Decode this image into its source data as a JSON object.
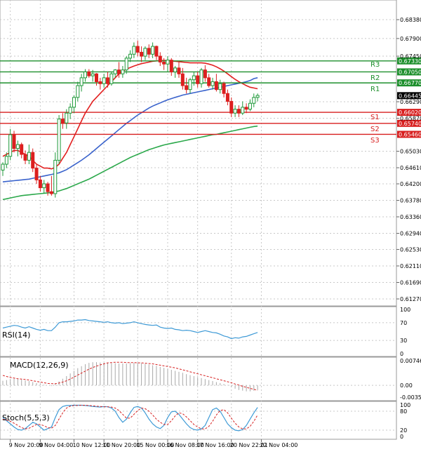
{
  "colors": {
    "bull": "#1f9a3a",
    "bear": "#dc1f1f",
    "sma_fast": "#e22020",
    "sma_mid": "#3a63cc",
    "sma_slow": "#2aa84a",
    "resistance": "#1d8f2c",
    "support": "#d81e1e",
    "rsi": "#3e9ad6",
    "macd_hist": "#a8a8a8",
    "macd_signal": "#d62020",
    "stoch_k": "#3e9ad6",
    "stoch_d": "#d62020",
    "grid": "#c8c8c8"
  },
  "chart_data": {
    "type": "candlestick",
    "price_axis_ticks": [
      "0.68380",
      "0.67900",
      "0.67450",
      "0.67330",
      "0.67050",
      "0.66770",
      "0.66445",
      "0.66290",
      "0.66020",
      "0.65870",
      "0.65740",
      "0.65460",
      "0.65030",
      "0.64610",
      "0.64200",
      "0.63780",
      "0.63360",
      "0.62940",
      "0.62530",
      "0.62110",
      "0.61690",
      "0.61270"
    ],
    "current_price": "0.66445",
    "time_labels": [
      {
        "label": "9 Nov 20:00",
        "bar": 2
      },
      {
        "label": "9 Nov 04:00",
        "bar": 10
      },
      {
        "label": "10 Nov 12:00",
        "bar": 19
      },
      {
        "label": "11 Nov 20:00",
        "bar": 27
      },
      {
        "label": "15 Nov 00:00",
        "bar": 36
      },
      {
        "label": "16 Nov 08:00",
        "bar": 44
      },
      {
        "label": "17 Nov 16:00",
        "bar": 52
      },
      {
        "label": "20 Nov 22:01",
        "bar": 61
      },
      {
        "label": "22 Nov 04:00",
        "bar": 69
      }
    ],
    "levels": [
      {
        "name": "R3",
        "value": 0.6733,
        "label": "0.67330",
        "kind": "resistance"
      },
      {
        "name": "R2",
        "value": 0.6705,
        "label": "0.67050",
        "kind": "resistance"
      },
      {
        "name": "R1",
        "value": 0.6677,
        "label": "0.66770",
        "kind": "resistance"
      },
      {
        "name": "S1",
        "value": 0.6602,
        "label": "0.66020",
        "kind": "support"
      },
      {
        "name": "S2",
        "value": 0.6574,
        "label": "0.65740",
        "kind": "support"
      },
      {
        "name": "S3",
        "value": 0.6546,
        "label": "0.65460",
        "kind": "support"
      }
    ],
    "ohlc": [
      [
        0.6455,
        0.6475,
        0.644,
        0.647
      ],
      [
        0.647,
        0.65,
        0.646,
        0.649
      ],
      [
        0.649,
        0.656,
        0.648,
        0.6545
      ],
      [
        0.6545,
        0.6555,
        0.65,
        0.651
      ],
      [
        0.651,
        0.653,
        0.649,
        0.652
      ],
      [
        0.652,
        0.6525,
        0.6485,
        0.6495
      ],
      [
        0.6495,
        0.6505,
        0.647,
        0.648
      ],
      [
        0.648,
        0.652,
        0.647,
        0.65
      ],
      [
        0.65,
        0.651,
        0.645,
        0.646
      ],
      [
        0.646,
        0.647,
        0.642,
        0.643
      ],
      [
        0.643,
        0.644,
        0.64,
        0.641
      ],
      [
        0.641,
        0.643,
        0.6395,
        0.642
      ],
      [
        0.642,
        0.6425,
        0.639,
        0.64
      ],
      [
        0.64,
        0.644,
        0.639,
        0.6395
      ],
      [
        0.6395,
        0.65,
        0.6385,
        0.648
      ],
      [
        0.648,
        0.6595,
        0.647,
        0.6585
      ],
      [
        0.6585,
        0.66,
        0.656,
        0.6575
      ],
      [
        0.6575,
        0.661,
        0.656,
        0.66
      ],
      [
        0.66,
        0.6625,
        0.6585,
        0.6615
      ],
      [
        0.6615,
        0.6645,
        0.66,
        0.664
      ],
      [
        0.664,
        0.668,
        0.663,
        0.667
      ],
      [
        0.667,
        0.67,
        0.6655,
        0.669
      ],
      [
        0.669,
        0.6712,
        0.668,
        0.6705
      ],
      [
        0.6705,
        0.6712,
        0.669,
        0.6695
      ],
      [
        0.6695,
        0.671,
        0.668,
        0.67
      ],
      [
        0.67,
        0.6702,
        0.667,
        0.668
      ],
      [
        0.668,
        0.669,
        0.666,
        0.6675
      ],
      [
        0.6675,
        0.67,
        0.6665,
        0.669
      ],
      [
        0.669,
        0.6705,
        0.6665,
        0.6675
      ],
      [
        0.6675,
        0.6705,
        0.667,
        0.67
      ],
      [
        0.67,
        0.6712,
        0.669,
        0.671
      ],
      [
        0.671,
        0.673,
        0.669,
        0.67
      ],
      [
        0.67,
        0.672,
        0.669,
        0.671
      ],
      [
        0.671,
        0.6745,
        0.67,
        0.674
      ],
      [
        0.674,
        0.676,
        0.673,
        0.675
      ],
      [
        0.675,
        0.678,
        0.674,
        0.677
      ],
      [
        0.677,
        0.6785,
        0.6745,
        0.6755
      ],
      [
        0.6755,
        0.677,
        0.673,
        0.6745
      ],
      [
        0.6745,
        0.677,
        0.6735,
        0.6765
      ],
      [
        0.6765,
        0.6775,
        0.674,
        0.675
      ],
      [
        0.675,
        0.678,
        0.674,
        0.677
      ],
      [
        0.677,
        0.6772,
        0.6735,
        0.6745
      ],
      [
        0.6745,
        0.6755,
        0.672,
        0.673
      ],
      [
        0.673,
        0.674,
        0.671,
        0.6725
      ],
      [
        0.6725,
        0.6745,
        0.6705,
        0.6735
      ],
      [
        0.6735,
        0.674,
        0.6695,
        0.6705
      ],
      [
        0.6705,
        0.672,
        0.669,
        0.6715
      ],
      [
        0.6715,
        0.673,
        0.669,
        0.67
      ],
      [
        0.67,
        0.6715,
        0.666,
        0.667
      ],
      [
        0.667,
        0.669,
        0.665,
        0.666
      ],
      [
        0.666,
        0.669,
        0.665,
        0.6685
      ],
      [
        0.6685,
        0.6705,
        0.667,
        0.6695
      ],
      [
        0.6695,
        0.6705,
        0.6665,
        0.6675
      ],
      [
        0.6675,
        0.6715,
        0.6665,
        0.671
      ],
      [
        0.671,
        0.6722,
        0.668,
        0.669
      ],
      [
        0.669,
        0.67,
        0.6665,
        0.667
      ],
      [
        0.667,
        0.669,
        0.666,
        0.668
      ],
      [
        0.668,
        0.67,
        0.6655,
        0.666
      ],
      [
        0.666,
        0.6685,
        0.665,
        0.6675
      ],
      [
        0.6675,
        0.668,
        0.664,
        0.665
      ],
      [
        0.665,
        0.666,
        0.662,
        0.663
      ],
      [
        0.663,
        0.664,
        0.659,
        0.66
      ],
      [
        0.66,
        0.662,
        0.659,
        0.661
      ],
      [
        0.661,
        0.662,
        0.659,
        0.66
      ],
      [
        0.66,
        0.663,
        0.6595,
        0.6615
      ],
      [
        0.6615,
        0.6625,
        0.66,
        0.661
      ],
      [
        0.661,
        0.6635,
        0.6605,
        0.6625
      ],
      [
        0.6625,
        0.665,
        0.6615,
        0.664
      ],
      [
        0.664,
        0.665,
        0.663,
        0.6645
      ]
    ],
    "sma_fast": [
      0.649,
      0.6495,
      0.65,
      0.6505,
      0.6505,
      0.65,
      0.6495,
      0.649,
      0.648,
      0.647,
      0.6465,
      0.646,
      0.646,
      0.6458,
      0.6462,
      0.647,
      0.6485,
      0.65,
      0.652,
      0.654,
      0.656,
      0.658,
      0.66,
      0.6615,
      0.663,
      0.664,
      0.665,
      0.666,
      0.667,
      0.668,
      0.669,
      0.67,
      0.6706,
      0.6712,
      0.6716,
      0.672,
      0.6723,
      0.6726,
      0.6728,
      0.673,
      0.6732,
      0.6733,
      0.6734,
      0.6734,
      0.6734,
      0.6733,
      0.6732,
      0.6731,
      0.673,
      0.6729,
      0.6728,
      0.6728,
      0.6728,
      0.6728,
      0.6727,
      0.6725,
      0.6722,
      0.6718,
      0.6713,
      0.6707,
      0.67,
      0.6693,
      0.6686,
      0.668,
      0.6675,
      0.667,
      0.6666,
      0.6664,
      0.6662
    ],
    "sma_mid": [
      0.6425,
      0.6426,
      0.6427,
      0.6428,
      0.6429,
      0.643,
      0.6431,
      0.6432,
      0.6434,
      0.6436,
      0.6438,
      0.644,
      0.6442,
      0.6444,
      0.6446,
      0.6448,
      0.6452,
      0.6456,
      0.6462,
      0.6468,
      0.6474,
      0.648,
      0.6487,
      0.6494,
      0.6502,
      0.651,
      0.6518,
      0.6526,
      0.6534,
      0.6542,
      0.655,
      0.6558,
      0.6566,
      0.6574,
      0.6581,
      0.6588,
      0.6595,
      0.6601,
      0.6607,
      0.6613,
      0.6618,
      0.6622,
      0.6626,
      0.663,
      0.6634,
      0.6637,
      0.664,
      0.6643,
      0.6646,
      0.6648,
      0.665,
      0.6652,
      0.6654,
      0.6656,
      0.6658,
      0.666,
      0.6662,
      0.6664,
      0.6666,
      0.6668,
      0.667,
      0.6672,
      0.6674,
      0.6676,
      0.6678,
      0.668,
      0.6683,
      0.6688,
      0.669
    ],
    "sma_slow": [
      0.638,
      0.6382,
      0.6384,
      0.6386,
      0.6388,
      0.639,
      0.6391,
      0.6392,
      0.6393,
      0.6394,
      0.6395,
      0.6396,
      0.6397,
      0.6398,
      0.64,
      0.6402,
      0.6405,
      0.6408,
      0.6412,
      0.6416,
      0.642,
      0.6424,
      0.6428,
      0.6432,
      0.6437,
      0.6442,
      0.6447,
      0.6452,
      0.6457,
      0.6462,
      0.6467,
      0.6472,
      0.6477,
      0.6482,
      0.6487,
      0.6491,
      0.6495,
      0.6499,
      0.6503,
      0.6507,
      0.651,
      0.6513,
      0.6516,
      0.6519,
      0.6521,
      0.6523,
      0.6525,
      0.6527,
      0.6529,
      0.6531,
      0.6533,
      0.6535,
      0.6537,
      0.6539,
      0.6541,
      0.6543,
      0.6545,
      0.6546,
      0.6548,
      0.655,
      0.6552,
      0.6554,
      0.6556,
      0.6558,
      0.656,
      0.6562,
      0.6564,
      0.6566,
      0.6567
    ],
    "rsi": {
      "label": "RSI(14)",
      "ticks": [
        100,
        70,
        30,
        0
      ],
      "values": [
        58,
        60,
        62,
        64,
        63,
        60,
        58,
        61,
        58,
        55,
        53,
        55,
        52,
        52,
        60,
        70,
        72,
        72,
        73,
        74,
        76,
        76,
        77,
        75,
        74,
        73,
        72,
        71,
        72,
        70,
        69,
        70,
        68,
        69,
        70,
        72,
        70,
        68,
        66,
        65,
        64,
        65,
        60,
        58,
        57,
        58,
        55,
        54,
        52,
        53,
        52,
        50,
        48,
        50,
        52,
        50,
        48,
        47,
        44,
        40,
        38,
        34,
        36,
        35,
        38,
        39,
        42,
        45,
        48
      ]
    },
    "macd": {
      "label": "MACD(12,26,9)",
      "ticks": [
        "0.007464",
        "0.00",
        "-0.003568"
      ],
      "histogram": [
        0.0014,
        0.0016,
        0.0018,
        0.002,
        0.0019,
        0.0017,
        0.0015,
        0.0013,
        0.001,
        0.0007,
        0.0004,
        0.0002,
        0.0,
        -0.0002,
        0.0004,
        0.0012,
        0.002,
        0.0028,
        0.0036,
        0.0044,
        0.0052,
        0.0058,
        0.0064,
        0.0068,
        0.007,
        0.007,
        0.0069,
        0.0068,
        0.0068,
        0.0067,
        0.0067,
        0.0066,
        0.0066,
        0.0066,
        0.0067,
        0.0068,
        0.0068,
        0.0067,
        0.0065,
        0.0063,
        0.0061,
        0.0059,
        0.0056,
        0.0053,
        0.005,
        0.0047,
        0.0044,
        0.0041,
        0.0038,
        0.0034,
        0.0031,
        0.0028,
        0.0025,
        0.0022,
        0.0019,
        0.0016,
        0.0013,
        0.001,
        0.0007,
        0.0004,
        0.0001,
        -0.0005,
        -0.001,
        -0.0014,
        -0.0016,
        -0.0018,
        -0.0018,
        -0.0016,
        -0.0014
      ],
      "signal": [
        0.003,
        0.0027,
        0.0024,
        0.0022,
        0.002,
        0.0019,
        0.0018,
        0.0016,
        0.0014,
        0.0012,
        0.001,
        0.0008,
        0.0006,
        0.0005,
        0.0005,
        0.0007,
        0.001,
        0.0014,
        0.0019,
        0.0025,
        0.0031,
        0.0037,
        0.0043,
        0.0049,
        0.0054,
        0.0058,
        0.0062,
        0.0065,
        0.0068,
        0.0069,
        0.007,
        0.007,
        0.007,
        0.0069,
        0.0069,
        0.0069,
        0.0068,
        0.0068,
        0.0067,
        0.0066,
        0.0065,
        0.0063,
        0.0061,
        0.0059,
        0.0057,
        0.0055,
        0.0053,
        0.005,
        0.0047,
        0.0044,
        0.0041,
        0.0038,
        0.0035,
        0.0032,
        0.0029,
        0.0026,
        0.0023,
        0.002,
        0.0017,
        0.0014,
        0.0011,
        0.0008,
        0.0004,
        0.0001,
        -0.0003,
        -0.0006,
        -0.0009,
        -0.0012,
        -0.0015
      ]
    },
    "stoch": {
      "label": "Stoch(5,5,3)",
      "ticks": [
        100,
        80,
        20,
        0
      ],
      "k": [
        60,
        50,
        40,
        30,
        22,
        20,
        25,
        35,
        45,
        40,
        30,
        20,
        25,
        30,
        60,
        85,
        95,
        98,
        98,
        99,
        99,
        99,
        98,
        97,
        95,
        94,
        93,
        95,
        94,
        90,
        80,
        60,
        45,
        55,
        75,
        92,
        95,
        90,
        75,
        55,
        40,
        30,
        25,
        35,
        60,
        78,
        80,
        70,
        55,
        40,
        28,
        22,
        20,
        24,
        35,
        60,
        85,
        90,
        80,
        60,
        40,
        28,
        20,
        18,
        22,
        35,
        55,
        75,
        92
      ],
      "d": [
        55,
        52,
        48,
        42,
        35,
        28,
        24,
        26,
        32,
        38,
        38,
        34,
        28,
        26,
        35,
        55,
        75,
        90,
        96,
        98,
        98,
        99,
        99,
        98,
        97,
        96,
        95,
        94,
        94,
        93,
        90,
        82,
        70,
        58,
        58,
        70,
        82,
        90,
        88,
        80,
        68,
        55,
        45,
        38,
        38,
        50,
        65,
        75,
        72,
        62,
        50,
        38,
        30,
        24,
        24,
        32,
        48,
        68,
        82,
        85,
        75,
        58,
        42,
        30,
        24,
        24,
        32,
        48,
        68
      ]
    }
  },
  "labels": {
    "r3": "R3",
    "r2": "R2",
    "r1": "R1",
    "s1": "S1",
    "s2": "S2",
    "s3": "S3"
  }
}
